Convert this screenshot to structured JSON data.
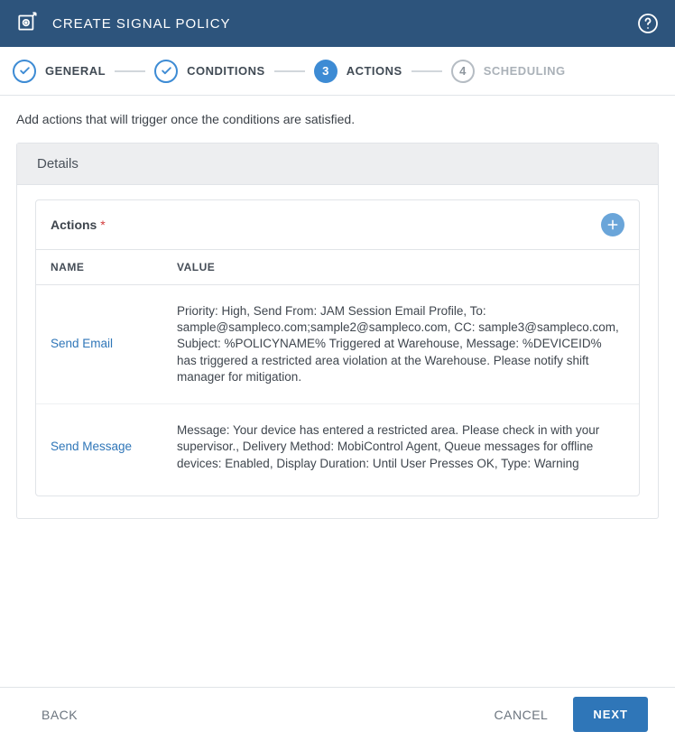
{
  "header": {
    "title": "CREATE SIGNAL POLICY"
  },
  "steps": [
    {
      "label": "GENERAL",
      "state": "done",
      "num": "1"
    },
    {
      "label": "CONDITIONS",
      "state": "done",
      "num": "2"
    },
    {
      "label": "ACTIONS",
      "state": "current",
      "num": "3"
    },
    {
      "label": "SCHEDULING",
      "state": "upcoming",
      "num": "4"
    }
  ],
  "subtitle": "Add actions that will trigger once the conditions are satisfied.",
  "panel": {
    "heading": "Details",
    "card_title": "Actions",
    "required_mark": "*",
    "columns": {
      "name": "NAME",
      "value": "VALUE"
    },
    "rows": [
      {
        "name": "Send Email",
        "value": "Priority: High, Send From: JAM Session Email Profile, To: sample@sampleco.com;sample2@sampleco.com, CC: sample3@sampleco.com, Subject: %POLICYNAME% Triggered at Warehouse, Message: %DEVICEID% has triggered a restricted area violation at the Warehouse. Please notify shift manager for mitigation."
      },
      {
        "name": "Send Message",
        "value": "Message: Your device has entered a restricted area. Please check in with your supervisor., Delivery Method: MobiControl Agent, Queue messages for offline devices: Enabled, Display Duration: Until User Presses OK, Type: Warning"
      }
    ]
  },
  "footer": {
    "back": "BACK",
    "cancel": "CANCEL",
    "next": "NEXT"
  }
}
